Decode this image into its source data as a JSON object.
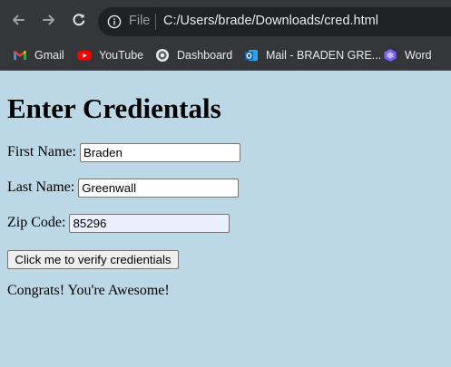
{
  "browser": {
    "address_scheme_label": "File",
    "url": "C:/Users/brade/Downloads/cred.html",
    "bookmarks": [
      {
        "label": "Gmail",
        "icon": "gmail-icon"
      },
      {
        "label": "YouTube",
        "icon": "youtube-icon"
      },
      {
        "label": "Dashboard",
        "icon": "dashboard-icon"
      },
      {
        "label": "Mail - BRADEN GRE...",
        "icon": "outlook-mail-icon"
      },
      {
        "label": "Word",
        "icon": "word-icon"
      }
    ]
  },
  "page": {
    "title": "Enter Credientals",
    "first_name": {
      "label": "First Name:",
      "value": "Braden"
    },
    "last_name": {
      "label": "Last Name:",
      "value": "Greenwall"
    },
    "zip_code": {
      "label": "Zip Code:",
      "value": "85296"
    },
    "verify_button_label": "Click me to verify credientials",
    "message": "Congrats! You're Awesome!"
  },
  "colors": {
    "page_background": "#bcd7e5",
    "chrome_toolbar": "#35363a",
    "omnibox": "#202124",
    "autofill_background": "#e8f0fe"
  }
}
